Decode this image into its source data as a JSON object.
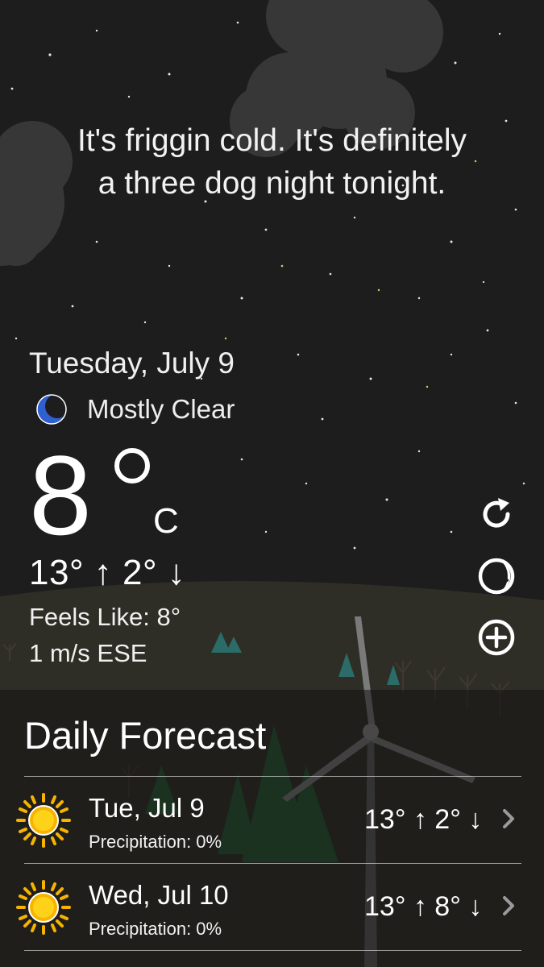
{
  "message": {
    "line1": "It's friggin cold. It's definitely",
    "line2": "a three dog night tonight."
  },
  "current": {
    "date": "Tuesday, July 9",
    "condition_icon": "crescent-moon-icon",
    "condition": "Mostly Clear",
    "temperature": "8",
    "unit": "C",
    "hi_lo": "13° ↑  2° ↓",
    "feels_like": "Feels Like: 8°",
    "wind": "1 m/s ESE"
  },
  "side_actions": [
    {
      "name": "refresh",
      "icon": "refresh-icon"
    },
    {
      "name": "moon-phase",
      "icon": "moon-phase-icon"
    },
    {
      "name": "add-location",
      "icon": "add-circle-icon"
    }
  ],
  "forecast": {
    "title": "Daily Forecast",
    "days": [
      {
        "day": "Tue, Jul 9",
        "precip": "Precipitation: 0%",
        "temps": "13° ↑  2° ↓",
        "icon": "sun-icon"
      },
      {
        "day": "Wed, Jul 10",
        "precip": "Precipitation: 0%",
        "temps": "13° ↑  8° ↓",
        "icon": "sun-icon"
      }
    ]
  },
  "colors": {
    "sky": "#1d1d1e",
    "cloud": "#3a3a3b",
    "ground": "#2f2e26",
    "moon": "#2f5fd0",
    "sun": "#f6b400",
    "text": "#ffffff"
  }
}
